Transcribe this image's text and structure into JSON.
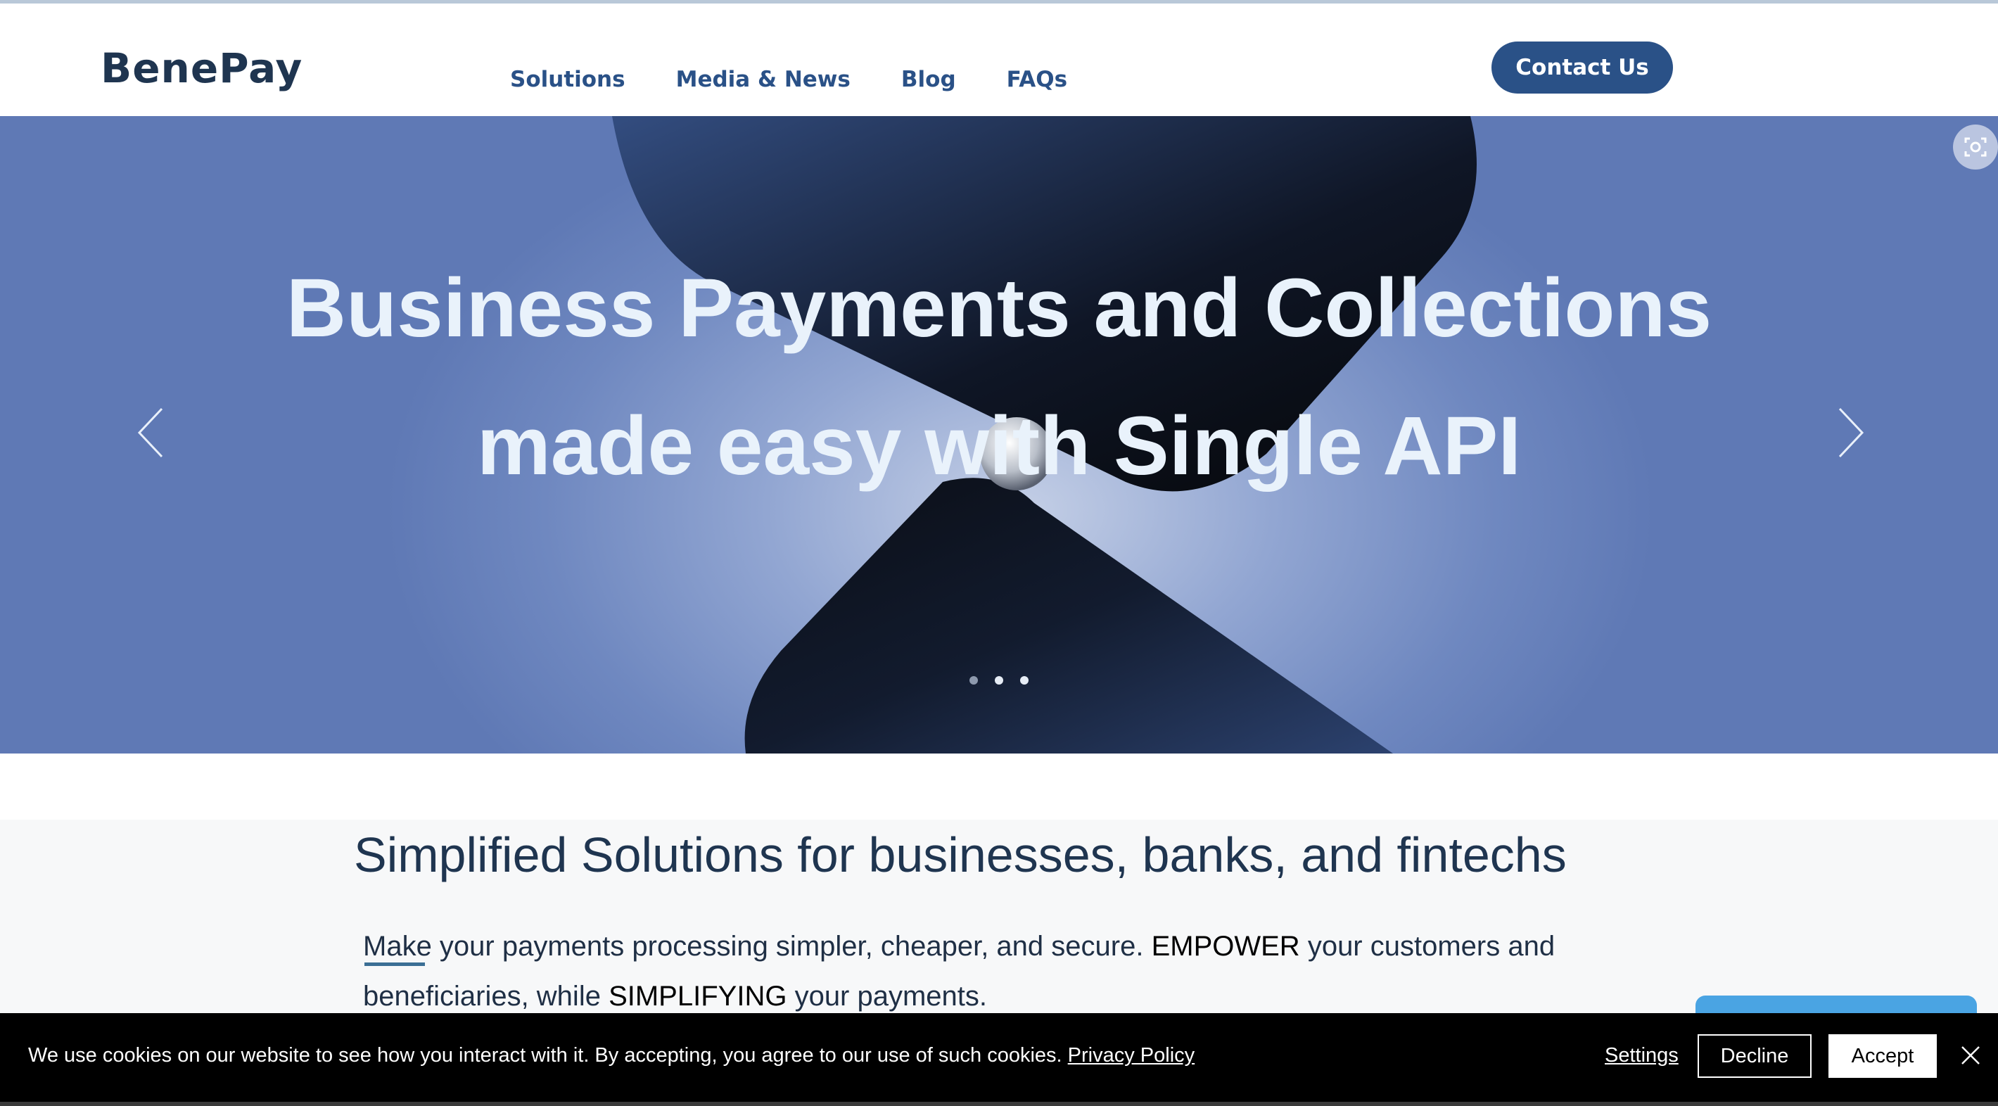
{
  "header": {
    "logo": "BenePay",
    "nav": [
      "Solutions",
      "Media & News",
      "Blog",
      "FAQs"
    ],
    "contact_label": "Contact Us"
  },
  "hero": {
    "title_line1": "Business Payments and Collections",
    "title_line2": "made easy with Single API",
    "slides": 3,
    "active_slide": 1,
    "prev_icon": "chevron-left-icon",
    "next_icon": "chevron-right-icon"
  },
  "section": {
    "title": "Simplified Solutions for businesses, banks, and fintechs",
    "p1": "Make",
    "p2": " your payments processing simpler, cheaper, and secure. ",
    "p3": "EMPOWER",
    "p4": " your customers and beneficiaries, while ",
    "p5": "SIMPLIFYING",
    "p6": " your payments."
  },
  "cookie": {
    "text": "We use cookies on our website to see how you interact with it. By accepting, you agree to our use of such cookies.",
    "privacy_link": "Privacy Policy",
    "settings_label": "Settings",
    "decline_label": "Decline",
    "accept_label": "Accept",
    "close_icon": "close-icon"
  },
  "colors": {
    "brand_dark": "#1f3550",
    "brand_blue": "#2a5187",
    "hero_text": "#e9f2fb"
  }
}
